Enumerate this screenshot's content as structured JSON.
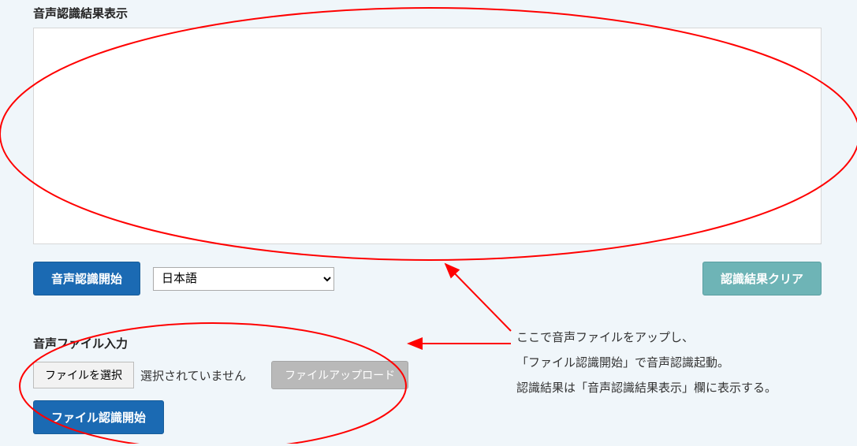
{
  "result": {
    "heading": "音声認識結果表示",
    "textarea_value": "",
    "start_button": "音声認識開始",
    "language_selected": "日本語",
    "clear_button": "認識結果クリア"
  },
  "file": {
    "heading": "音声ファイル入力",
    "choose_button": "ファイルを選択",
    "status_text": "選択されていません",
    "upload_button": "ファイルアップロード",
    "recognize_button": "ファイル認識開始"
  },
  "annotation": {
    "line1": "ここで音声ファイルをアップし、",
    "line2": "「ファイル認識開始」で音声認識起動。",
    "line3": "認識結果は「音声認識結果表示」欄に表示する。"
  }
}
